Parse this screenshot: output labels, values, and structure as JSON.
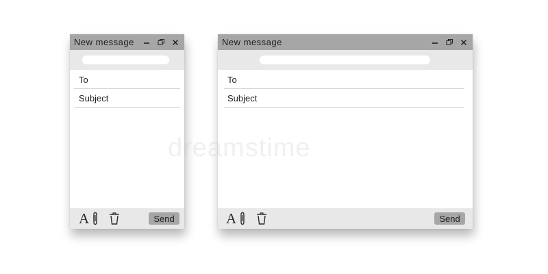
{
  "windows": [
    {
      "title": "New message",
      "fields": {
        "to_label": "To",
        "subject_label": "Subject"
      },
      "send_label": "Send",
      "font_tool_label": "A"
    },
    {
      "title": "New message",
      "fields": {
        "to_label": "To",
        "subject_label": "Subject"
      },
      "send_label": "Send",
      "font_tool_label": "A"
    }
  ],
  "watermark": "dreamstime",
  "colors": {
    "titlebar": "#a6a6a6",
    "toolbar": "#e8e8e9",
    "send_button": "#a6a6a6",
    "text": "#1e1e1e"
  },
  "icons": {
    "window_controls": [
      "minimize-icon",
      "restore-icon",
      "close-icon"
    ],
    "footer_tools": [
      "font-icon",
      "paperclip-icon",
      "trash-icon"
    ]
  }
}
